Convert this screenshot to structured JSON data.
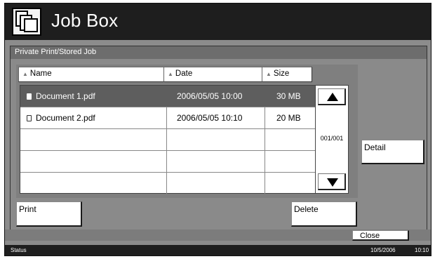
{
  "header": {
    "title": "Job Box",
    "icon": "job-box-icon"
  },
  "panel": {
    "title": "Private Print/Stored Job"
  },
  "columns": {
    "name": "Name",
    "date": "Date",
    "size": "Size"
  },
  "rows": [
    {
      "name": "Document 1.pdf",
      "date": "2006/05/05 10:00",
      "size": "30 MB",
      "selected": true
    },
    {
      "name": "Document 2.pdf",
      "date": "2006/05/05 10:10",
      "size": "20 MB",
      "selected": false
    }
  ],
  "pager": {
    "indicator": "001/001"
  },
  "buttons": {
    "detail": "Detail",
    "print": "Print",
    "delete": "Delete",
    "close": "Close"
  },
  "status": {
    "label": "Status",
    "date": "10/5/2006",
    "time": "10:10"
  }
}
